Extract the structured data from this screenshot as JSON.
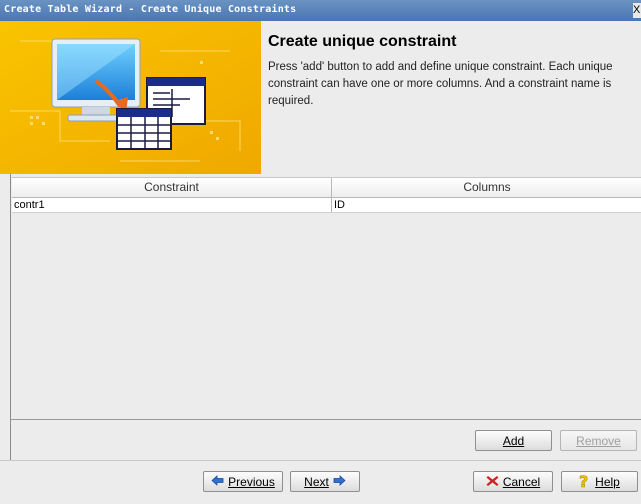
{
  "window": {
    "title": "Create Table Wizard - Create Unique Constraints",
    "close_glyph": "X"
  },
  "header": {
    "heading": "Create unique constraint",
    "description": "Press 'add' button to add and define unique constraint. Each unique constraint can have one or more columns. And a constraint name is required."
  },
  "table": {
    "columns": [
      "Constraint",
      "Columns"
    ],
    "rows": [
      {
        "constraint": "contr1",
        "columns": "ID"
      }
    ]
  },
  "buttons": {
    "add": "Add",
    "remove": "Remove",
    "previous": "Previous",
    "next": "Next",
    "cancel": "Cancel",
    "help": "Help"
  },
  "icons": {
    "previous": "arrow-left-icon",
    "next": "arrow-right-icon",
    "cancel": "red-x-icon",
    "help": "question-mark-icon",
    "banner": "computer-to-table-illustration"
  },
  "colors": {
    "titlebar": "#5b86bd",
    "banner": "#f7b500",
    "arrow_blue": "#2f6fd6",
    "cancel_red": "#d42020",
    "help_yellow": "#f2c400"
  }
}
